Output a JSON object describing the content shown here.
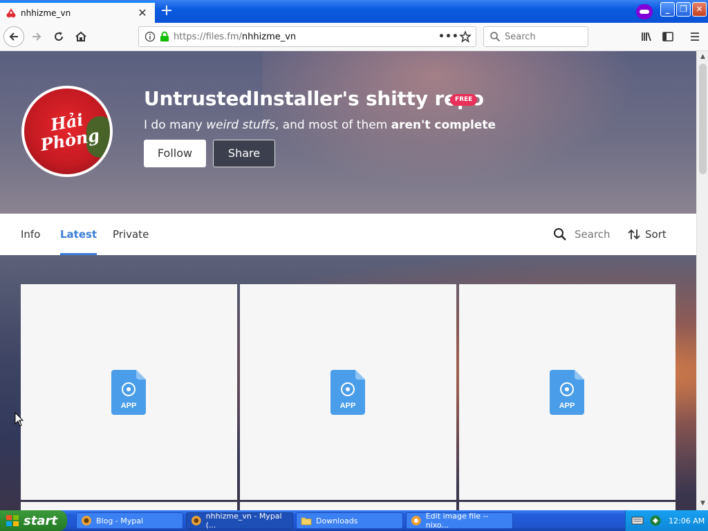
{
  "browser": {
    "tab_title": "nhhizme_vn",
    "new_tab": "+",
    "url_prefix": "https://files.fm/",
    "url_path": "nhhizme_vn",
    "search_placeholder": "Search"
  },
  "profile": {
    "title": "UntrustedInstaller's shitty repo",
    "badge": "FREE",
    "desc_1": "I do many ",
    "desc_em": "weird stuffs",
    "desc_2": ", and most of them ",
    "desc_bold": "aren't complete",
    "follow_label": "Follow",
    "share_label": "Share",
    "avatar_text": "Hải Phòng"
  },
  "page_tabs": {
    "info": "Info",
    "latest": "Latest",
    "private": "Private",
    "active": "Latest",
    "search_placeholder": "Search",
    "sort": "Sort"
  },
  "files": [
    {
      "type_label": "APP"
    },
    {
      "type_label": "APP"
    },
    {
      "type_label": "APP"
    }
  ],
  "taskbar": {
    "start": "start",
    "tasks": [
      {
        "label": "Blog - Mypal",
        "active": false
      },
      {
        "label": "nhhizme_vn - Mypal (...",
        "active": true
      },
      {
        "label": "Downloads",
        "active": false
      },
      {
        "label": "Edit image file -- nixo...",
        "active": false
      }
    ],
    "clock": "12:06 AM"
  },
  "colors": {
    "accent": "#3b7dd8",
    "badge": "#e8305a",
    "file_icon": "#4a9de8"
  }
}
